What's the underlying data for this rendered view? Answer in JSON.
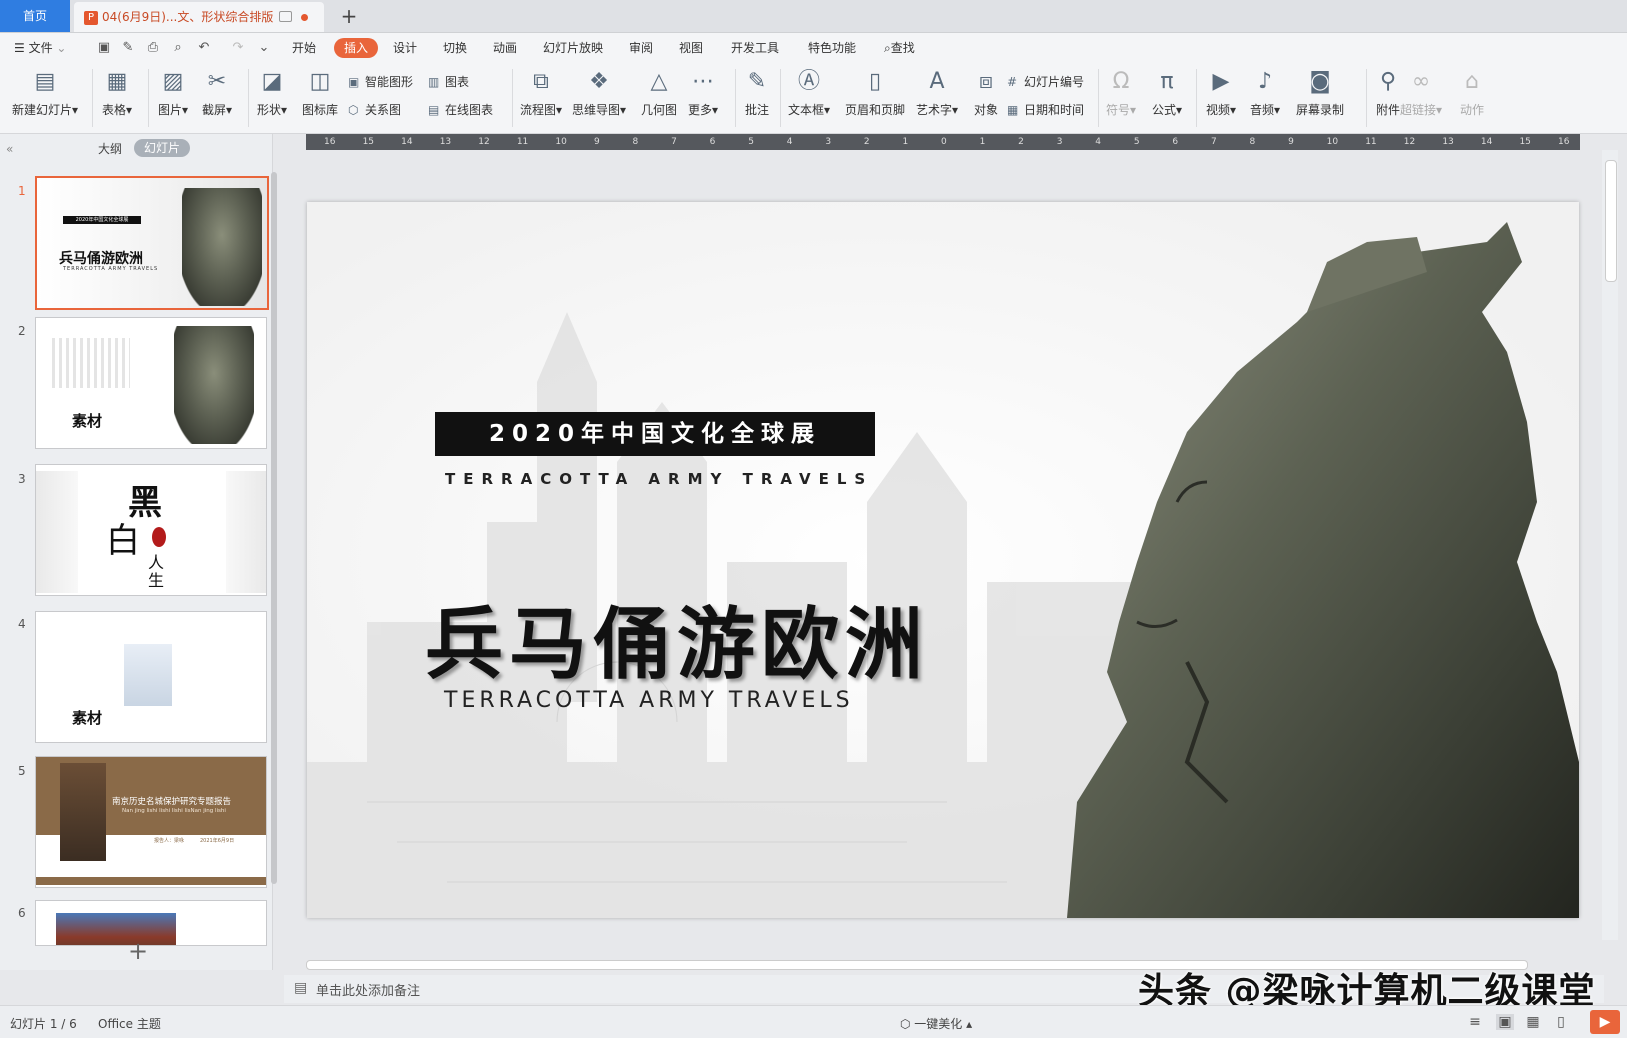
{
  "tabs": {
    "home": "首页",
    "document": "04(6月9日)...文、形状综合排版",
    "add": "+"
  },
  "menu": {
    "file": "文件",
    "items": [
      "开始",
      "插入",
      "设计",
      "切换",
      "动画",
      "幻灯片放映",
      "审阅",
      "视图",
      "开发工具",
      "特色功能"
    ],
    "search": "查找"
  },
  "ribbon": {
    "new_slide": "新建幻灯片",
    "table": "表格",
    "picture": "图片",
    "screenshot": "截屏",
    "shape": "形状",
    "icon_lib": "图标库",
    "smart_shape": "智能图形",
    "chart": "图表",
    "relation": "关系图",
    "online_chart": "在线图表",
    "flowchart": "流程图",
    "mindmap": "思维导图",
    "geometry": "几何图",
    "more": "更多",
    "comment": "批注",
    "textbox": "文本框",
    "header_footer": "页眉和页脚",
    "wordart": "艺术字",
    "object": "对象",
    "slide_number": "幻灯片编号",
    "datetime": "日期和时间",
    "symbol": "符号",
    "formula": "公式",
    "video": "视频",
    "audio": "音频",
    "screen_record": "屏幕录制",
    "attachment": "附件",
    "hyperlink": "超链接",
    "action": "动作"
  },
  "left_pane": {
    "outline": "大纲",
    "slides": "幻灯片",
    "numbers": [
      "1",
      "2",
      "3",
      "4",
      "5",
      "6"
    ],
    "thumb1_title": "兵马俑游欧洲",
    "thumb1_banner": "2020年中国文化全球展",
    "thumb1_sub": "TERRACOTTA ARMY TRAVELS",
    "thumb2_label": "素材",
    "thumb3_big1": "黑",
    "thumb3_big2": "白",
    "thumb3_small1": "人",
    "thumb3_small2": "生",
    "thumb4_label": "素材",
    "thumb5_title": "南京历史名城保护研究专题报告",
    "thumb5_sub": "Nan jing lishi lishi lishi lisNan jing lishi",
    "thumb5_meta1": "报告人：梁咏",
    "thumb5_meta2": "2021年6月9日"
  },
  "ruler_ticks": [
    "16",
    "15",
    "14",
    "13",
    "12",
    "11",
    "10",
    "9",
    "8",
    "7",
    "6",
    "5",
    "4",
    "3",
    "2",
    "1",
    "0",
    "1",
    "2",
    "3",
    "4",
    "5",
    "6",
    "7",
    "8",
    "9",
    "10",
    "11",
    "12",
    "13",
    "14",
    "15",
    "16"
  ],
  "slide": {
    "banner": "2020年中国文化全球展",
    "subtitle_top": "TERRACOTTA ARMY TRAVELS",
    "title": "兵马俑游欧洲",
    "subtitle_bottom": "TERRACOTTA ARMY TRAVELS"
  },
  "notes_placeholder": "单击此处添加备注",
  "watermark": "头条 @梁咏计算机二级课堂",
  "status": {
    "slide_info": "幻灯片 1 / 6",
    "theme": "Office 主题",
    "beautify": "一键美化"
  },
  "colors": {
    "accent": "#e9653b",
    "home_tab": "#2f7de1"
  }
}
